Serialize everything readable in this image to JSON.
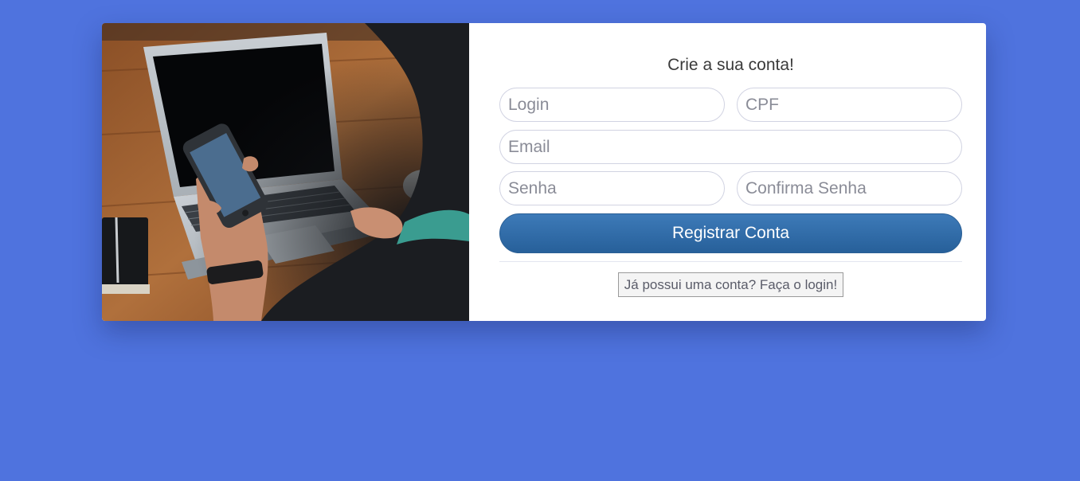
{
  "colors": {
    "page_background": "#4f73de",
    "card_background": "#ffffff",
    "button_primary": "#2f6aa6",
    "button_text": "#ffffff"
  },
  "image": {
    "subject": "person at wooden desk holding a smartphone in front of a laptop"
  },
  "form": {
    "title": "Crie a sua conta!",
    "fields": {
      "login": {
        "placeholder": "Login",
        "value": ""
      },
      "cpf": {
        "placeholder": "CPF",
        "value": ""
      },
      "email": {
        "placeholder": "Email",
        "value": ""
      },
      "password": {
        "placeholder": "Senha",
        "value": ""
      },
      "confirm_password": {
        "placeholder": "Confirma Senha",
        "value": ""
      }
    },
    "submit_label": "Registrar Conta",
    "login_link_label": "Já possui uma conta? Faça o login!"
  }
}
